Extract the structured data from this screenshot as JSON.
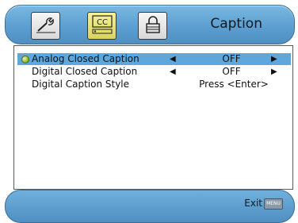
{
  "header": {
    "title": "Caption",
    "tabs": [
      {
        "icon": "wrench-icon",
        "active": false
      },
      {
        "icon": "cc-icon",
        "label": "CC",
        "active": true
      },
      {
        "icon": "lock-icon",
        "active": false
      }
    ]
  },
  "menu": {
    "items": [
      {
        "label": "Analog Closed Caption",
        "value": "OFF",
        "selected": true
      },
      {
        "label": "Digital Closed Caption",
        "value": "OFF",
        "selected": false
      },
      {
        "label": "Digital Caption Style",
        "value": "Press <Enter>",
        "selected": false
      }
    ]
  },
  "footer": {
    "exit_label": "Exit",
    "menu_key_label": "MENU"
  },
  "colors": {
    "bar_blue": "#5d9fd0",
    "selected_row": "#5da7dc",
    "active_tab": "#e6e27a"
  }
}
